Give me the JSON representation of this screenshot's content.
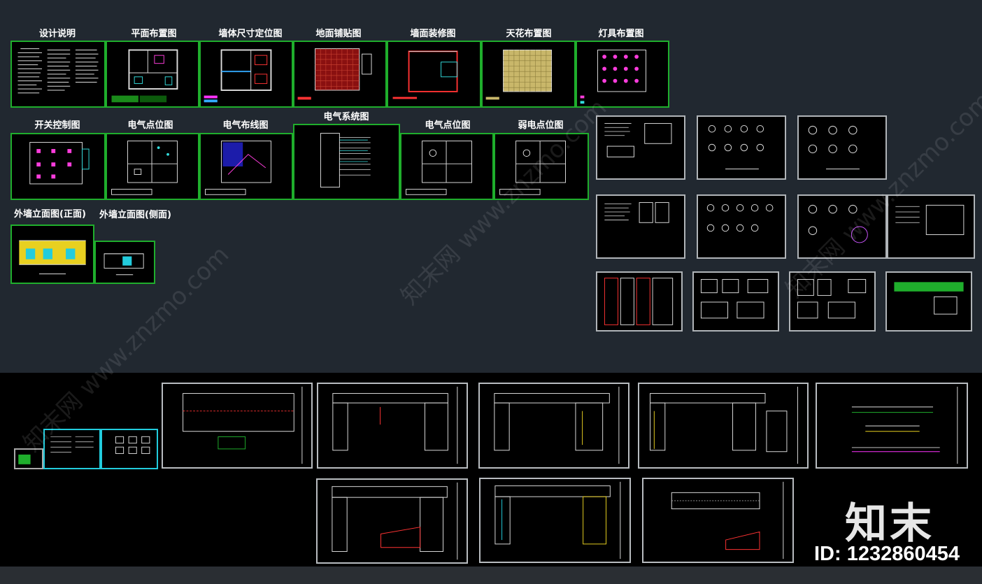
{
  "top_row_titles": [
    "设计说明",
    "平面布置图",
    "墙体尺寸定位图",
    "地面铺贴图",
    "墙面装修图",
    "天花布置图",
    "灯具布置图"
  ],
  "mid_row_titles": [
    "开关控制图",
    "电气点位图",
    "电气布线图",
    "电气系统图",
    "电气点位图",
    "弱电点位图"
  ],
  "elevation_titles": [
    "外墙立面图(正面)",
    "外墙立面图(侧面)"
  ],
  "brand": {
    "logo_text": "知末",
    "id_text": "ID: 1232860454"
  },
  "watermark": {
    "text": "知末网 www.znzmo.com"
  },
  "colors": {
    "sheet_border": "#1fae2c",
    "panel_top": "#212830",
    "panel_bottom": "#000000"
  }
}
